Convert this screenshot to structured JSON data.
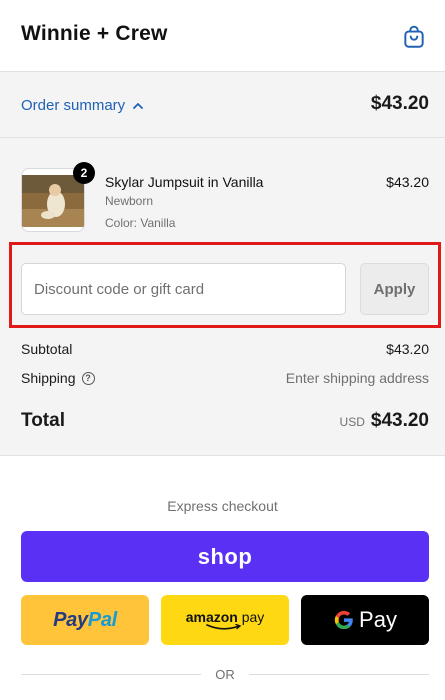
{
  "header": {
    "brand": "Winnie + Crew",
    "cart_icon": "shopping-bag-icon"
  },
  "summary": {
    "toggle_label": "Order summary",
    "toggle_icon": "chevron-up-icon",
    "total": "$43.20"
  },
  "line_item": {
    "quantity": "2",
    "name": "Skylar Jumpsuit in Vanilla",
    "variant": "Newborn",
    "color": "Color: Vanilla",
    "price": "$43.20"
  },
  "discount": {
    "placeholder": "Discount code or gift card",
    "apply_label": "Apply"
  },
  "totals": {
    "subtotal_label": "Subtotal",
    "subtotal_value": "$43.20",
    "shipping_label": "Shipping",
    "shipping_help_icon": "question-circle-icon",
    "shipping_value": "Enter shipping address",
    "total_label": "Total",
    "currency": "USD",
    "total_value": "$43.20"
  },
  "express": {
    "title": "Express checkout",
    "shop_label": "shop",
    "paypal_part1": "Pay",
    "paypal_part2": "Pal",
    "amazon_part1": "amazon",
    "amazon_part2": " pay",
    "gpay_label": "Pay",
    "or_label": "OR"
  },
  "colors": {
    "link": "#1f61b5",
    "shop": "#5a31f4",
    "paypal": "#ffc439",
    "amazon": "#ffd814",
    "highlight": "#e11919"
  }
}
